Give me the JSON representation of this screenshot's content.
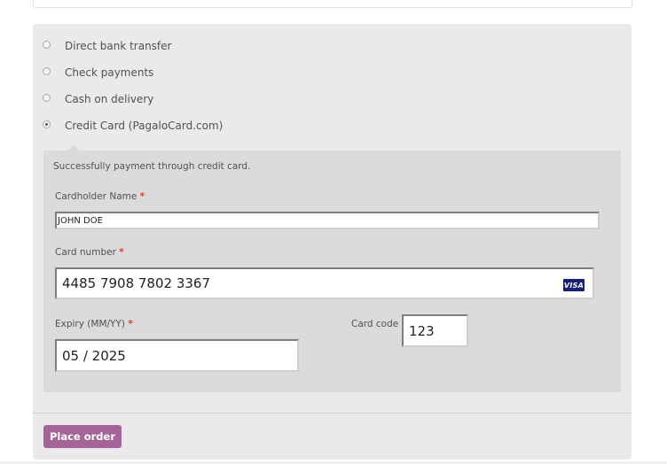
{
  "payment_methods": [
    {
      "label": "Direct bank transfer",
      "selected": false
    },
    {
      "label": "Check payments",
      "selected": false
    },
    {
      "label": "Cash on delivery",
      "selected": false
    },
    {
      "label": "Credit Card (PagaloCard.com)",
      "selected": true
    }
  ],
  "credit_card": {
    "description": "Successfully payment through credit card.",
    "cardholder_label": "Cardholder Name",
    "cardholder_value": "JOHN DOE",
    "number_label": "Card number",
    "number_value": "4485 7908 7802 3367",
    "card_brand": "VISA",
    "expiry_label": "Expiry (MM/YY)",
    "expiry_value": "05 / 2025",
    "code_label": "Card code",
    "code_value": "123",
    "required_mark": "*"
  },
  "place_order_label": "Place order",
  "colors": {
    "box_bg": "#ebe9eb",
    "panel_bg": "#dcdadc",
    "button_bg": "#a46497",
    "required": "#e2401c"
  }
}
